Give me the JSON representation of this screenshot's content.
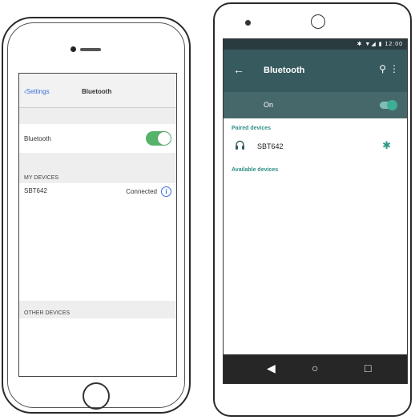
{
  "ios": {
    "nav": {
      "back_label": "Settings",
      "title": "Bluetooth"
    },
    "bluetooth_row": {
      "label": "Bluetooth",
      "enabled": true,
      "toggle_color": "#55b36a"
    },
    "my_devices_header": "MY DEVICES",
    "device": {
      "name": "SBT642",
      "status": "Connected",
      "info_glyph": "i"
    },
    "other_devices_header": "OTHER DEVICES"
  },
  "android": {
    "status_icons": "✱ ▼◢ ▮ 12:00",
    "toolbar": {
      "back_icon": "←",
      "title": "Bluetooth",
      "search_icon": "⚲",
      "more_icon": "⋮"
    },
    "toggle_row": {
      "label": "On",
      "enabled": true
    },
    "paired_header": "Paired devices",
    "device": {
      "name": "SBT642",
      "headphones_icon": "🎧",
      "settings_icon": "✱"
    },
    "available_header": "Available devices",
    "navbar": {
      "back": "◀",
      "home": "○",
      "recents": "□"
    },
    "colors": {
      "toolbar": "#375a5e",
      "status_bar": "#2a3b3f",
      "accent": "#2f8f86"
    }
  }
}
